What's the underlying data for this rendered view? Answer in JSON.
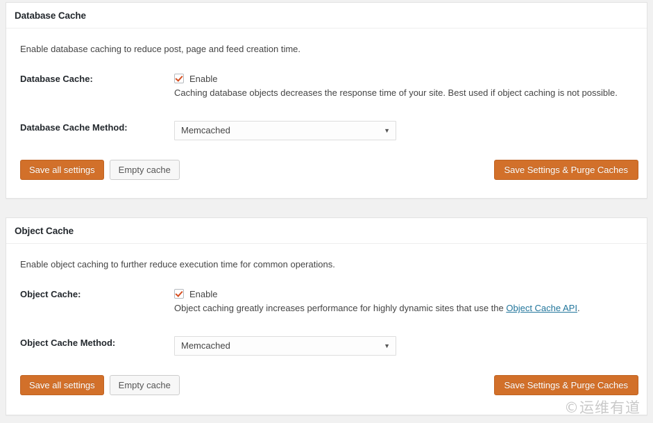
{
  "panels": [
    {
      "id": "database",
      "header": "Database Cache",
      "intro": "Enable database caching to reduce post, page and feed creation time.",
      "enable_label": "Database Cache:",
      "checkbox_label": "Enable",
      "checkbox_checked": true,
      "help_text": "Caching database objects decreases the response time of your site. Best used if object caching is not possible.",
      "method_label": "Database Cache Method:",
      "method_value": "Memcached",
      "method_options": [
        "Memcached"
      ],
      "save_label": "Save all settings",
      "empty_label": "Empty cache",
      "purge_label": "Save Settings & Purge Caches"
    },
    {
      "id": "object",
      "header": "Object Cache",
      "intro": "Enable object caching to further reduce execution time for common operations.",
      "enable_label": "Object Cache:",
      "checkbox_label": "Enable",
      "checkbox_checked": true,
      "help_text_before": "Object caching greatly increases performance for highly dynamic sites that use the ",
      "help_link": "Object Cache API",
      "help_text_after": ".",
      "method_label": "Object Cache Method:",
      "method_value": "Memcached",
      "method_options": [
        "Memcached"
      ],
      "save_label": "Save all settings",
      "empty_label": "Empty cache",
      "purge_label": "Save Settings & Purge Caches"
    }
  ],
  "icons": {
    "select_arrow": "▼",
    "checkmark": "check-icon"
  },
  "colors": {
    "accent_orange": "#d2702a",
    "check_orange": "#d54e21",
    "link_blue": "#21759b",
    "page_background": "#f1f1f1",
    "panel_background": "#ffffff",
    "panel_border": "#e3e3e3"
  },
  "watermark": "©运维有道"
}
